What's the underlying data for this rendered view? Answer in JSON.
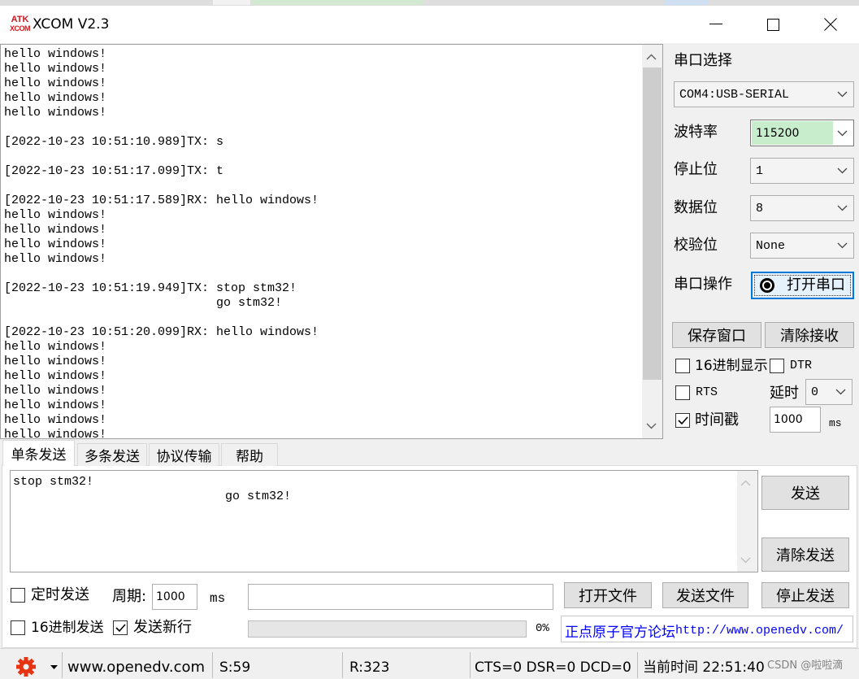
{
  "window": {
    "logo_top": "ATK",
    "logo_bottom": "XCOM",
    "title": "XCOM V2.3"
  },
  "receive": {
    "text": "hello windows!\nhello windows!\nhello windows!\nhello windows!\nhello windows!\n\n[2022-10-23 10:51:10.989]TX: s\n\n[2022-10-23 10:51:17.099]TX: t\n\n[2022-10-23 10:51:17.589]RX: hello windows!\nhello windows!\nhello windows!\nhello windows!\nhello windows!\n\n[2022-10-23 10:51:19.949]TX: stop stm32!\n                             go stm32!\n\n[2022-10-23 10:51:20.099]RX: hello windows!\nhello windows!\nhello windows!\nhello windows!\nhello windows!\nhello windows!\nhello windows!\nhello windows!"
  },
  "serial": {
    "port_label": "串口选择",
    "port_value": "COM4:USB-SERIAL",
    "baud_label": "波特率",
    "baud_value": "115200",
    "stop_label": "停止位",
    "stop_value": "1",
    "data_label": "数据位",
    "data_value": "8",
    "parity_label": "校验位",
    "parity_value": "None",
    "operation_label": "串口操作",
    "open_button": "打开串口",
    "save_window_button": "保存窗口",
    "clear_receive_button": "清除接收",
    "hex_display_label": "16进制显示",
    "hex_display_checked": false,
    "dtr_label": "DTR",
    "dtr_checked": false,
    "rts_label": "RTS",
    "rts_checked": false,
    "delay_label": "延时",
    "delay_value": "0",
    "timestamp_label": "时间戳",
    "timestamp_checked": true,
    "timestamp_value": "1000",
    "timestamp_unit": "ms"
  },
  "tabs": [
    {
      "label": "单条发送",
      "active": true
    },
    {
      "label": "多条发送",
      "active": false
    },
    {
      "label": "协议传输",
      "active": false
    },
    {
      "label": "帮助",
      "active": false
    }
  ],
  "send": {
    "text": "stop stm32!\n                             go stm32!",
    "send_button": "发送",
    "clear_button": "清除发送",
    "timed_send_label": "定时发送",
    "timed_send_checked": false,
    "period_label": "周期:",
    "period_value": "1000",
    "period_unit": "ms",
    "open_file_button": "打开文件",
    "send_file_button": "发送文件",
    "stop_send_button": "停止发送",
    "hex_send_label": "16进制发送",
    "hex_send_checked": false,
    "newline_label": "发送新行",
    "newline_checked": true,
    "progress_percent": 0,
    "progress_text": "0%",
    "forum_label": "正点原子官方论坛",
    "forum_url": "http://www.openedv.com/"
  },
  "status": {
    "site": "www.openedv.com",
    "sent": "S:59",
    "received": "R:323",
    "lines": "CTS=0 DSR=0 DCD=0",
    "time": "当前时间 22:51:40",
    "watermark": "CSDN @啦啦滴"
  },
  "colors": {
    "focus_blue": "#0078d7",
    "baud_highlight": "#c7edcc",
    "link_blue": "#0000ff",
    "gear_red": "#e63312",
    "logo_red": "#d2161e"
  }
}
